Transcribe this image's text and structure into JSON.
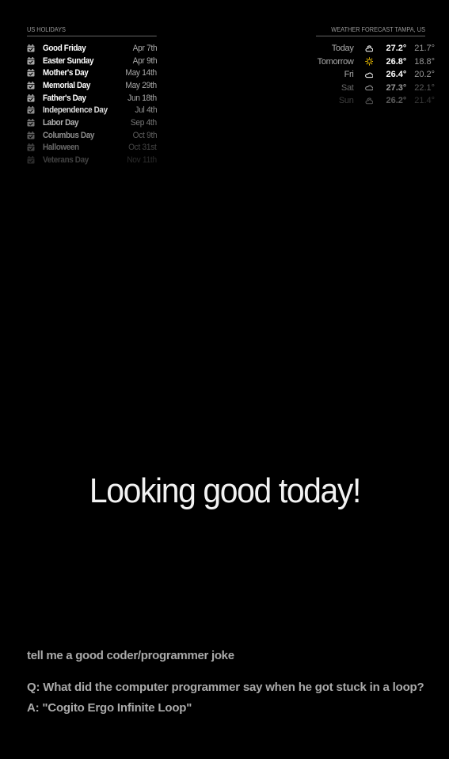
{
  "holidays": {
    "header": "US HOLIDAYS",
    "items": [
      {
        "name": "Good Friday",
        "date": "Apr 7th",
        "opacity": 1.0
      },
      {
        "name": "Easter Sunday",
        "date": "Apr 9th",
        "opacity": 1.0
      },
      {
        "name": "Mother's Day",
        "date": "May 14th",
        "opacity": 1.0
      },
      {
        "name": "Memorial Day",
        "date": "May 29th",
        "opacity": 1.0
      },
      {
        "name": "Father's Day",
        "date": "Jun 18th",
        "opacity": 1.0
      },
      {
        "name": "Independence Day",
        "date": "Jul 4th",
        "opacity": 0.85
      },
      {
        "name": "Labor Day",
        "date": "Sep 4th",
        "opacity": 0.7
      },
      {
        "name": "Columbus Day",
        "date": "Oct 9th",
        "opacity": 0.55
      },
      {
        "name": "Halloween",
        "date": "Oct 31st",
        "opacity": 0.4
      },
      {
        "name": "Veterans Day",
        "date": "Nov 11th",
        "opacity": 0.25
      }
    ],
    "icon": "calendar-check-icon"
  },
  "weather": {
    "header": "WEATHER FORECAST TAMPA, US",
    "days": [
      {
        "day": "Today",
        "icon": "partly-cloudy-icon",
        "max": "27.2°",
        "min": "21.7°",
        "opacity": 1.0
      },
      {
        "day": "Tomorrow",
        "icon": "sun-icon",
        "max": "26.8°",
        "min": "18.8°",
        "opacity": 1.0
      },
      {
        "day": "Fri",
        "icon": "cloud-icon",
        "max": "26.4°",
        "min": "20.2°",
        "opacity": 1.0
      },
      {
        "day": "Sat",
        "icon": "cloud-icon",
        "max": "27.3°",
        "min": "22.1°",
        "opacity": 0.6
      },
      {
        "day": "Sun",
        "icon": "partly-cloudy-icon",
        "max": "26.2°",
        "min": "21.4°",
        "opacity": 0.35
      }
    ],
    "sun_color": "#ffcc00"
  },
  "compliment": {
    "text": "Looking good today!"
  },
  "assistant": {
    "query": "tell me a good coder/programmer joke",
    "answer_q": "Q: What did the computer programmer say when he got stuck in a loop?",
    "answer_a": "A: \"Cogito Ergo Infinite Loop\""
  }
}
